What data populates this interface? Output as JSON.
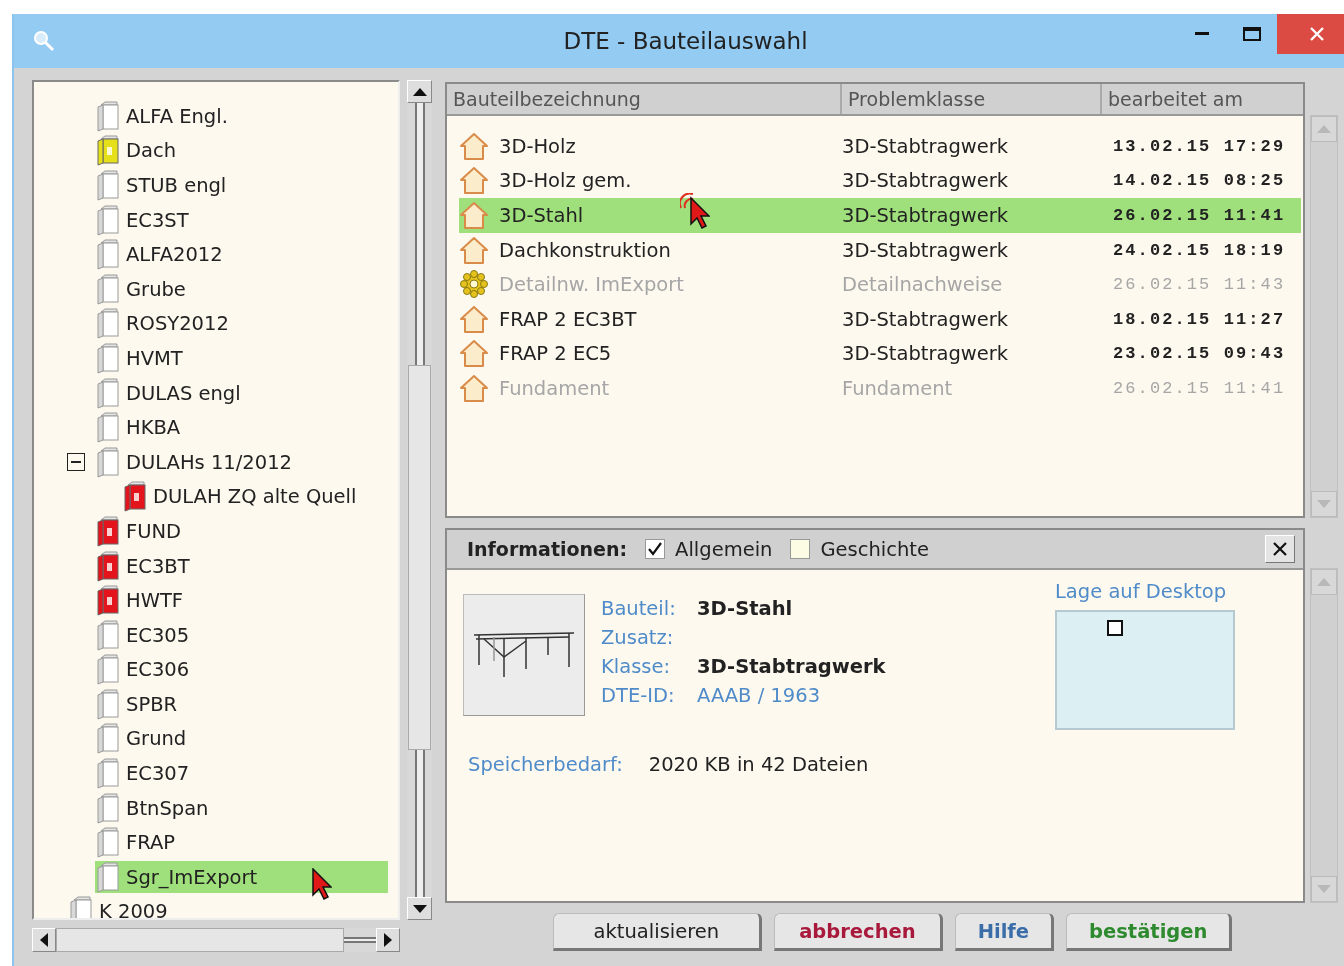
{
  "window": {
    "title": "DTE - Bauteilauswahl"
  },
  "tree": {
    "items": [
      {
        "children": [
          {
            "label": "ALFA Engl.",
            "color": "#ffffff",
            "selected": false
          },
          {
            "label": "Dach",
            "color": "#e6e01a",
            "selected": false
          },
          {
            "label": "STUB engl",
            "color": "#ffffff",
            "selected": false
          },
          {
            "label": "EC3ST",
            "color": "#ffffff",
            "selected": false
          },
          {
            "label": "ALFA2012",
            "color": "#ffffff",
            "selected": false
          },
          {
            "label": "Grube",
            "color": "#ffffff",
            "selected": false
          },
          {
            "label": "ROSY2012",
            "color": "#ffffff",
            "selected": false
          },
          {
            "label": "HVMT",
            "color": "#ffffff",
            "selected": false
          },
          {
            "label": "DULAS engl",
            "color": "#ffffff",
            "selected": false
          },
          {
            "label": "HKBA",
            "color": "#ffffff",
            "selected": false
          },
          {
            "label": "DULAHs 11/2012",
            "color": "#ffffff",
            "expanded": true,
            "selected": false,
            "children": [
              {
                "label": "DULAH ZQ alte Quell",
                "color": "#e3141c",
                "selected": false
              }
            ]
          },
          {
            "label": "FUND",
            "color": "#e3141c",
            "selected": false
          },
          {
            "label": "EC3BT",
            "color": "#e3141c",
            "selected": false
          },
          {
            "label": "HWTF",
            "color": "#e3141c",
            "selected": false
          },
          {
            "label": "EC305",
            "color": "#ffffff",
            "selected": false
          },
          {
            "label": "EC306",
            "color": "#ffffff",
            "selected": false
          },
          {
            "label": "SPBR",
            "color": "#ffffff",
            "selected": false
          },
          {
            "label": "Grund",
            "color": "#ffffff",
            "selected": false
          },
          {
            "label": "EC307",
            "color": "#ffffff",
            "selected": false
          },
          {
            "label": "BtnSpan",
            "color": "#ffffff",
            "selected": false
          },
          {
            "label": "FRAP",
            "color": "#ffffff",
            "selected": false
          },
          {
            "label": "Sgr_ImExport",
            "color": "#ffffff",
            "selected": true
          }
        ]
      },
      {
        "label": "K 2009",
        "color": "#ffffff",
        "selected": false
      }
    ]
  },
  "table": {
    "columns": [
      "Bauteilbezeichnung",
      "Problemklasse",
      "bearbeitet am"
    ],
    "rows": [
      {
        "kind": "house",
        "name": "3D-Holz",
        "class": "3D-Stabtragwerk",
        "edited": "13.02.15 17:29",
        "disabled": false,
        "selected": false
      },
      {
        "kind": "house",
        "name": "3D-Holz gem.",
        "class": "3D-Stabtragwerk",
        "edited": "14.02.15 08:25",
        "disabled": false,
        "selected": false
      },
      {
        "kind": "house",
        "name": "3D-Stahl",
        "class": "3D-Stabtragwerk",
        "edited": "26.02.15 11:41",
        "disabled": false,
        "selected": true
      },
      {
        "kind": "house",
        "name": "Dachkonstruktion",
        "class": "3D-Stabtragwerk",
        "edited": "24.02.15 18:19",
        "disabled": false,
        "selected": false
      },
      {
        "kind": "gear",
        "name": "Detailnw. ImExport",
        "class": "Detailnachweise",
        "edited": "26.02.15 11:43",
        "disabled": true,
        "selected": false
      },
      {
        "kind": "house",
        "name": "FRAP 2 EC3BT",
        "class": "3D-Stabtragwerk",
        "edited": "18.02.15 11:27",
        "disabled": false,
        "selected": false
      },
      {
        "kind": "house",
        "name": "FRAP 2 EC5",
        "class": "3D-Stabtragwerk",
        "edited": "23.02.15 09:43",
        "disabled": false,
        "selected": false
      },
      {
        "kind": "house",
        "name": "Fundament",
        "class": "Fundament",
        "edited": "26.02.15 11:41",
        "disabled": true,
        "selected": false
      }
    ]
  },
  "info": {
    "title": "Informationen:",
    "options": [
      {
        "label": "Allgemein",
        "checked": true
      },
      {
        "label": "Geschichte",
        "checked": false
      }
    ],
    "fields": [
      {
        "label": "Bauteil:",
        "value": "3D-Stahl",
        "kind": "bold"
      },
      {
        "label": "Zusatz:"
      },
      {
        "label": "Klasse:",
        "value": "3D-Stabtragwerk",
        "kind": "bold"
      },
      {
        "label": "DTE-ID:",
        "value": "AAAB / 1963",
        "kind": "link"
      }
    ],
    "storage": {
      "label": "Speicherbedarf:",
      "value": "2020 KB in 42 Dateien"
    },
    "desktop": {
      "label": "Lage auf Desktop"
    }
  },
  "buttons": [
    {
      "label": "aktualisieren",
      "color": "#222222"
    },
    {
      "label": "abbrechen",
      "color": "#a8193c"
    },
    {
      "label": "Hilfe",
      "color": "#3b6ea8"
    },
    {
      "label": "bestätigen",
      "color": "#2e8a2e"
    }
  ]
}
